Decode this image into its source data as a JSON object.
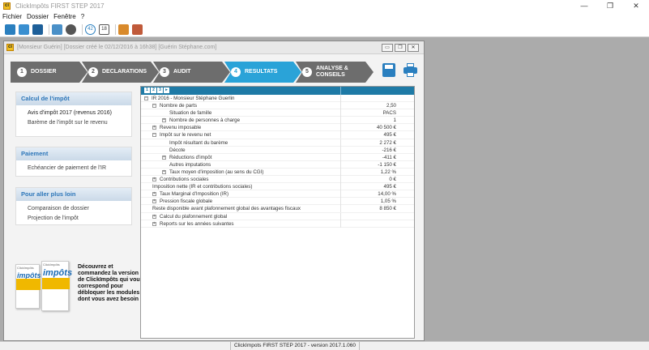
{
  "window": {
    "title": "ClickImpôts FIRST STEP 2017",
    "logo_text": "ci",
    "minimize": "—",
    "maximize": "❐",
    "close": "✕"
  },
  "menu": [
    "Fichier",
    "Dossier",
    "Fenêtre",
    "?"
  ],
  "toolbar": {
    "icons": [
      "new-file-icon",
      "open-folder-icon",
      "save-icon",
      "print-icon",
      "info-icon",
      "help-42-icon",
      "calendar-18-icon",
      "edit-pencil-icon",
      "tools-icon"
    ],
    "badge_42": "42",
    "badge_18": "18"
  },
  "child": {
    "title": "[Monsieur Guérin] [Dossier créé le 02/12/2016 à 16h38] [Guérin Stéphane.com]",
    "ctrl_min": "▭",
    "ctrl_restore": "❐",
    "ctrl_close": "✕"
  },
  "steps": [
    {
      "num": "1",
      "label": "DOSSIER"
    },
    {
      "num": "2",
      "label": "DECLARATIONS"
    },
    {
      "num": "3",
      "label": "AUDIT"
    },
    {
      "num": "4",
      "label": "RESULTATS"
    },
    {
      "num": "5",
      "label": "ANALYSE &\nCONSEILS"
    }
  ],
  "sidebar": {
    "calc": {
      "title": "Calcul de l'impôt",
      "items": [
        "Avis d'impôt 2017 (revenus 2016)",
        "Barème de l'impôt sur le revenu"
      ]
    },
    "paiement": {
      "title": "Paiement",
      "items": [
        "Echéancier de paiement de l'IR"
      ]
    },
    "plus": {
      "title": "Pour aller plus loin",
      "items": [
        "Comparaison de dossier",
        "Projection de l'impôt"
      ]
    }
  },
  "promo": {
    "box_brand": "impôts",
    "box_tag": "ClickImpôts",
    "text": "Découvrez et commandez la version de ClickImpôts qui vous correspond pour débloquer les modules dont vous avez besoin !"
  },
  "grid": {
    "header_tools": [
      "1",
      "2",
      "3",
      "▸"
    ],
    "rows": [
      {
        "label": "IR 2016 - Monsieur Stéphane Guerlin",
        "value": "",
        "toggle": "−",
        "level": 0
      },
      {
        "label": "Nombre de parts",
        "value": "2,50",
        "toggle": "−",
        "level": 1
      },
      {
        "label": "Situation de famille",
        "value": "PACS",
        "toggle": "",
        "level": 2
      },
      {
        "label": "Nombre de personnes à charge",
        "value": "1",
        "toggle": "+",
        "level": 2
      },
      {
        "label": "Revenu imposable",
        "value": "40 500 €",
        "toggle": "+",
        "level": 1
      },
      {
        "label": "Impôt sur le revenu net",
        "value": "495 €",
        "toggle": "−",
        "level": 1
      },
      {
        "label": "Impôt résultant du barème",
        "value": "2 272 €",
        "toggle": "",
        "level": 2
      },
      {
        "label": "Décote",
        "value": "-216 €",
        "toggle": "",
        "level": 2
      },
      {
        "label": "Réductions d'impôt",
        "value": "-411 €",
        "toggle": "+",
        "level": 2
      },
      {
        "label": "Autres imputations",
        "value": "-1 150 €",
        "toggle": "",
        "level": 2
      },
      {
        "label": "Taux moyen d'imposition (au sens du CGI)",
        "value": "1,22 %",
        "toggle": "+",
        "level": 2
      },
      {
        "label": "Contributions sociales",
        "value": "0 €",
        "toggle": "+",
        "level": 1
      },
      {
        "label": "Imposition nette (IR et contributions sociales)",
        "value": "495 €",
        "toggle": "",
        "level": 1
      },
      {
        "label": "Taux Marginal d'Imposition (IR)",
        "value": "14,00 %",
        "toggle": "+",
        "level": 1
      },
      {
        "label": "Pression fiscale globale",
        "value": "1,05 %",
        "toggle": "+",
        "level": 1
      },
      {
        "label": "Reste disponible avant plafonnement global des avantages fiscaux",
        "value": "8 850 €",
        "toggle": "",
        "level": 1
      },
      {
        "label": "Calcul du plafonnement global",
        "value": "",
        "toggle": "+",
        "level": 1
      },
      {
        "label": "Reports sur les années suivantes",
        "value": "",
        "toggle": "+",
        "level": 1
      }
    ]
  },
  "status": {
    "text": "ClickImpots FIRST STEP 2017 - version 2017.1.060"
  }
}
